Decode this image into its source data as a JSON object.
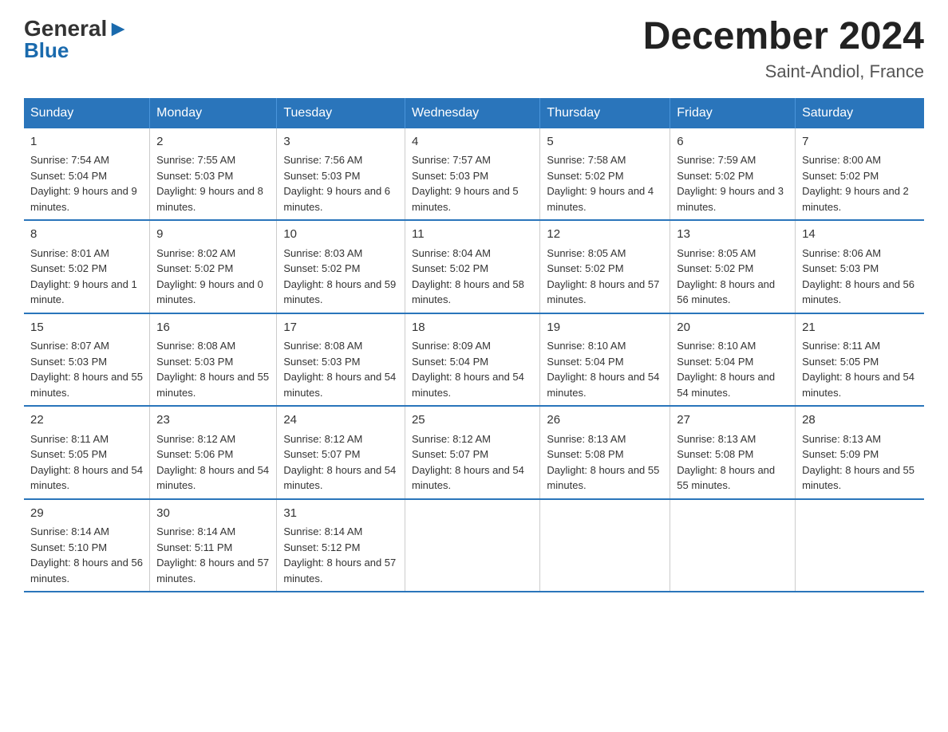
{
  "header": {
    "logo_black": "General",
    "logo_blue": "Blue",
    "title": "December 2024",
    "subtitle": "Saint-Andiol, France"
  },
  "days_of_week": [
    "Sunday",
    "Monday",
    "Tuesday",
    "Wednesday",
    "Thursday",
    "Friday",
    "Saturday"
  ],
  "weeks": [
    [
      {
        "day": "1",
        "sunrise": "7:54 AM",
        "sunset": "5:04 PM",
        "daylight": "9 hours and 9 minutes."
      },
      {
        "day": "2",
        "sunrise": "7:55 AM",
        "sunset": "5:03 PM",
        "daylight": "9 hours and 8 minutes."
      },
      {
        "day": "3",
        "sunrise": "7:56 AM",
        "sunset": "5:03 PM",
        "daylight": "9 hours and 6 minutes."
      },
      {
        "day": "4",
        "sunrise": "7:57 AM",
        "sunset": "5:03 PM",
        "daylight": "9 hours and 5 minutes."
      },
      {
        "day": "5",
        "sunrise": "7:58 AM",
        "sunset": "5:02 PM",
        "daylight": "9 hours and 4 minutes."
      },
      {
        "day": "6",
        "sunrise": "7:59 AM",
        "sunset": "5:02 PM",
        "daylight": "9 hours and 3 minutes."
      },
      {
        "day": "7",
        "sunrise": "8:00 AM",
        "sunset": "5:02 PM",
        "daylight": "9 hours and 2 minutes."
      }
    ],
    [
      {
        "day": "8",
        "sunrise": "8:01 AM",
        "sunset": "5:02 PM",
        "daylight": "9 hours and 1 minute."
      },
      {
        "day": "9",
        "sunrise": "8:02 AM",
        "sunset": "5:02 PM",
        "daylight": "9 hours and 0 minutes."
      },
      {
        "day": "10",
        "sunrise": "8:03 AM",
        "sunset": "5:02 PM",
        "daylight": "8 hours and 59 minutes."
      },
      {
        "day": "11",
        "sunrise": "8:04 AM",
        "sunset": "5:02 PM",
        "daylight": "8 hours and 58 minutes."
      },
      {
        "day": "12",
        "sunrise": "8:05 AM",
        "sunset": "5:02 PM",
        "daylight": "8 hours and 57 minutes."
      },
      {
        "day": "13",
        "sunrise": "8:05 AM",
        "sunset": "5:02 PM",
        "daylight": "8 hours and 56 minutes."
      },
      {
        "day": "14",
        "sunrise": "8:06 AM",
        "sunset": "5:03 PM",
        "daylight": "8 hours and 56 minutes."
      }
    ],
    [
      {
        "day": "15",
        "sunrise": "8:07 AM",
        "sunset": "5:03 PM",
        "daylight": "8 hours and 55 minutes."
      },
      {
        "day": "16",
        "sunrise": "8:08 AM",
        "sunset": "5:03 PM",
        "daylight": "8 hours and 55 minutes."
      },
      {
        "day": "17",
        "sunrise": "8:08 AM",
        "sunset": "5:03 PM",
        "daylight": "8 hours and 54 minutes."
      },
      {
        "day": "18",
        "sunrise": "8:09 AM",
        "sunset": "5:04 PM",
        "daylight": "8 hours and 54 minutes."
      },
      {
        "day": "19",
        "sunrise": "8:10 AM",
        "sunset": "5:04 PM",
        "daylight": "8 hours and 54 minutes."
      },
      {
        "day": "20",
        "sunrise": "8:10 AM",
        "sunset": "5:04 PM",
        "daylight": "8 hours and 54 minutes."
      },
      {
        "day": "21",
        "sunrise": "8:11 AM",
        "sunset": "5:05 PM",
        "daylight": "8 hours and 54 minutes."
      }
    ],
    [
      {
        "day": "22",
        "sunrise": "8:11 AM",
        "sunset": "5:05 PM",
        "daylight": "8 hours and 54 minutes."
      },
      {
        "day": "23",
        "sunrise": "8:12 AM",
        "sunset": "5:06 PM",
        "daylight": "8 hours and 54 minutes."
      },
      {
        "day": "24",
        "sunrise": "8:12 AM",
        "sunset": "5:07 PM",
        "daylight": "8 hours and 54 minutes."
      },
      {
        "day": "25",
        "sunrise": "8:12 AM",
        "sunset": "5:07 PM",
        "daylight": "8 hours and 54 minutes."
      },
      {
        "day": "26",
        "sunrise": "8:13 AM",
        "sunset": "5:08 PM",
        "daylight": "8 hours and 55 minutes."
      },
      {
        "day": "27",
        "sunrise": "8:13 AM",
        "sunset": "5:08 PM",
        "daylight": "8 hours and 55 minutes."
      },
      {
        "day": "28",
        "sunrise": "8:13 AM",
        "sunset": "5:09 PM",
        "daylight": "8 hours and 55 minutes."
      }
    ],
    [
      {
        "day": "29",
        "sunrise": "8:14 AM",
        "sunset": "5:10 PM",
        "daylight": "8 hours and 56 minutes."
      },
      {
        "day": "30",
        "sunrise": "8:14 AM",
        "sunset": "5:11 PM",
        "daylight": "8 hours and 57 minutes."
      },
      {
        "day": "31",
        "sunrise": "8:14 AM",
        "sunset": "5:12 PM",
        "daylight": "8 hours and 57 minutes."
      },
      null,
      null,
      null,
      null
    ]
  ],
  "labels": {
    "sunrise_prefix": "Sunrise: ",
    "sunset_prefix": "Sunset: ",
    "daylight_prefix": "Daylight: "
  }
}
